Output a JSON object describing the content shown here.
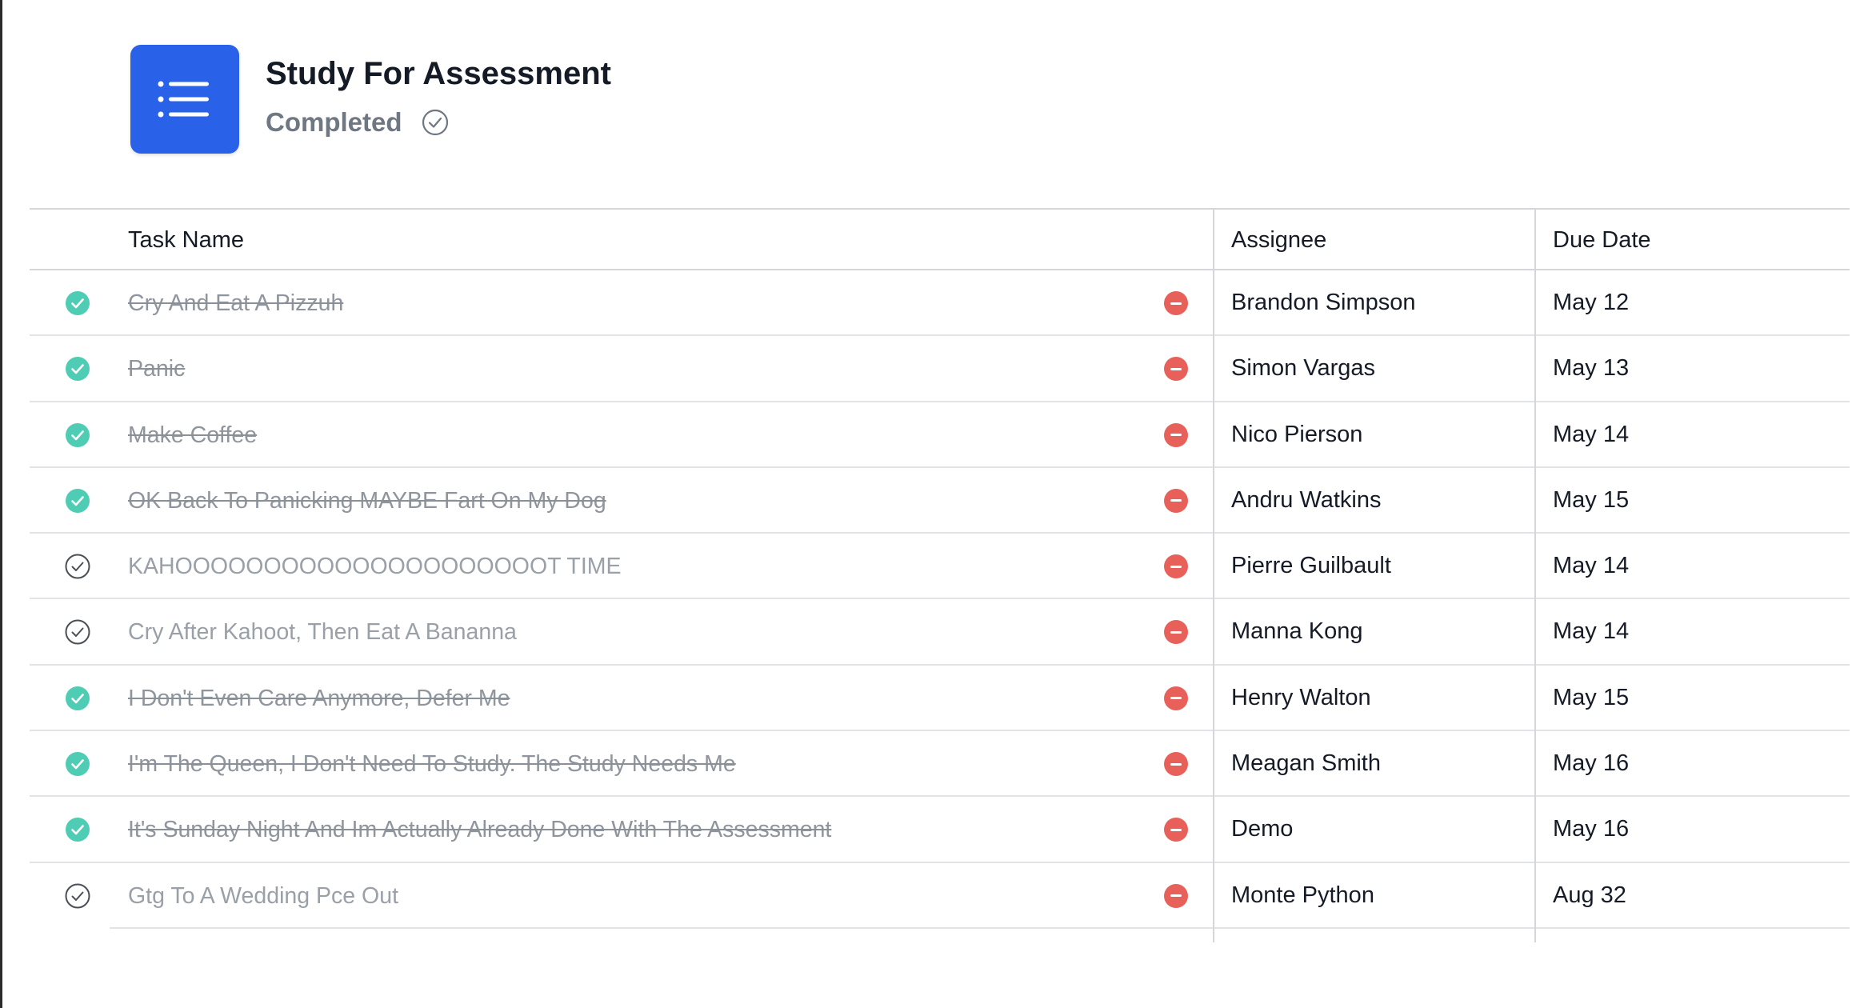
{
  "project": {
    "title": "Study For Assessment",
    "status": "Completed",
    "icon": "list-icon",
    "icon_color": "#2961e8"
  },
  "table": {
    "headers": {
      "task": "Task Name",
      "assignee": "Assignee",
      "due": "Due Date"
    },
    "rows": [
      {
        "task": "Cry And Eat A Pizzuh",
        "completed": true,
        "assignee": "Brandon Simpson",
        "due": "May 12"
      },
      {
        "task": "Panic",
        "completed": true,
        "assignee": "Simon Vargas",
        "due": "May 13"
      },
      {
        "task": "Make Coffee",
        "completed": true,
        "assignee": "Nico Pierson",
        "due": "May 14"
      },
      {
        "task": "OK Back To Panicking MAYBE Fart On My Dog",
        "completed": true,
        "assignee": "Andru Watkins",
        "due": "May 15"
      },
      {
        "task": "KAHOOOOOOOOOOOOOOOOOOOOOT TIME",
        "completed": false,
        "assignee": "Pierre Guilbault",
        "due": "May 14"
      },
      {
        "task": "Cry After Kahoot, Then Eat A Bananna",
        "completed": false,
        "assignee": "Manna Kong",
        "due": "May 14"
      },
      {
        "task": "I Don't Even Care Anymore, Defer Me",
        "completed": true,
        "assignee": "Henry Walton",
        "due": "May 15"
      },
      {
        "task": "I'm The Queen, I Don't Need To Study. The Study Needs Me",
        "completed": true,
        "assignee": "Meagan Smith",
        "due": "May 16"
      },
      {
        "task": "It's Sunday Night And Im Actually Already Done With The Assessment",
        "completed": true,
        "assignee": "Demo",
        "due": "May 16"
      },
      {
        "task": "Gtg To A Wedding Pce Out",
        "completed": false,
        "assignee": "Monte Python",
        "due": "Aug 32"
      }
    ]
  },
  "colors": {
    "complete_check": "#4ecdb4",
    "remove_button": "#e8605a",
    "accent": "#2961e8"
  },
  "icons": {
    "complete": "check-circle-filled-icon",
    "incomplete": "check-circle-outline-icon",
    "remove": "remove-circle-icon"
  }
}
